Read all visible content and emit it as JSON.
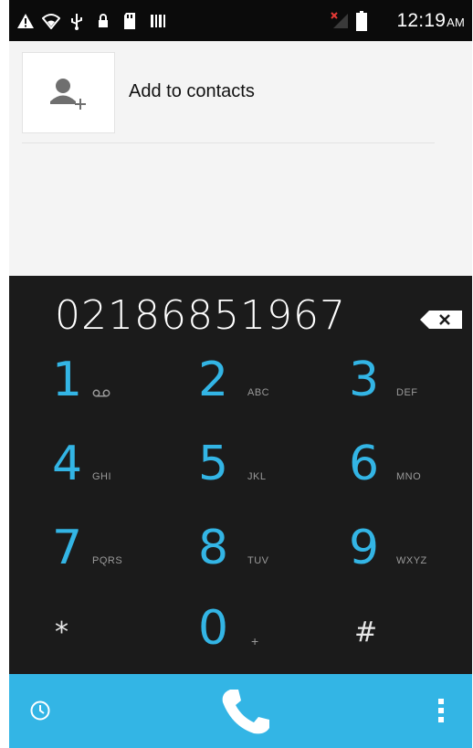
{
  "status_bar": {
    "time": "12:19",
    "ampm": "AM",
    "icons": [
      "warning-icon",
      "wifi-icon",
      "usb-icon",
      "lock-icon",
      "sd-card-icon",
      "barcode-icon",
      "no-signal-icon",
      "battery-icon"
    ]
  },
  "contacts": {
    "add_to_contacts_label": "Add to contacts",
    "add_icon": "add-contact-icon"
  },
  "dialpad": {
    "entered_number": "02186851967",
    "backspace_icon": "backspace-icon",
    "keys": [
      {
        "digit": "1",
        "letters": ""
      },
      {
        "digit": "2",
        "letters": "ABC"
      },
      {
        "digit": "3",
        "letters": "DEF"
      },
      {
        "digit": "4",
        "letters": "GHI"
      },
      {
        "digit": "5",
        "letters": "JKL"
      },
      {
        "digit": "6",
        "letters": "MNO"
      },
      {
        "digit": "7",
        "letters": "PQRS"
      },
      {
        "digit": "8",
        "letters": "TUV"
      },
      {
        "digit": "9",
        "letters": "WXYZ"
      },
      {
        "digit": "*",
        "letters": ""
      },
      {
        "digit": "0",
        "letters": "+"
      },
      {
        "digit": "#",
        "letters": ""
      }
    ]
  },
  "action_bar": {
    "history_icon": "clock-icon",
    "call_icon": "phone-icon",
    "menu_icon": "overflow-menu-icon"
  },
  "colors": {
    "accent": "#33b5e5",
    "dialpad_bg": "#1b1b1b",
    "content_bg": "#f4f4f4"
  }
}
